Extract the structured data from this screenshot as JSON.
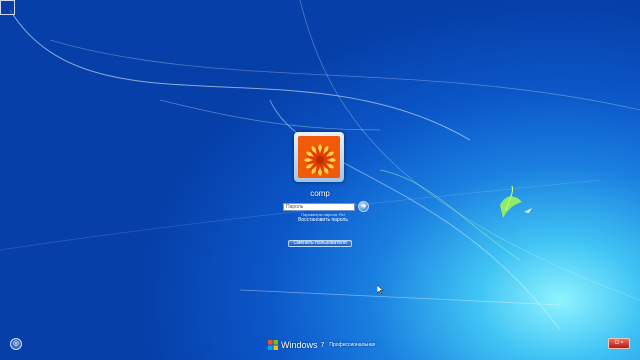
{
  "login": {
    "username": "comp",
    "password_placeholder": "Пароль",
    "language_hint": "Параметры пароля: RU",
    "reset_link": "Восстановить пароль",
    "switch_user_label": "Сменить пользователя"
  },
  "branding": {
    "product": "Windows",
    "version": "7",
    "edition": "Профессиональная"
  },
  "icons": {
    "corner": "restore-icon",
    "ease_of_access": "ease-of-access-icon",
    "submit": "arrow-right-icon",
    "power": "power-icon",
    "brand": "windows-flag-icon"
  },
  "colors": {
    "background_dark": "#063fa8",
    "background_light": "#8ff3ff",
    "power": "#c8301f"
  }
}
